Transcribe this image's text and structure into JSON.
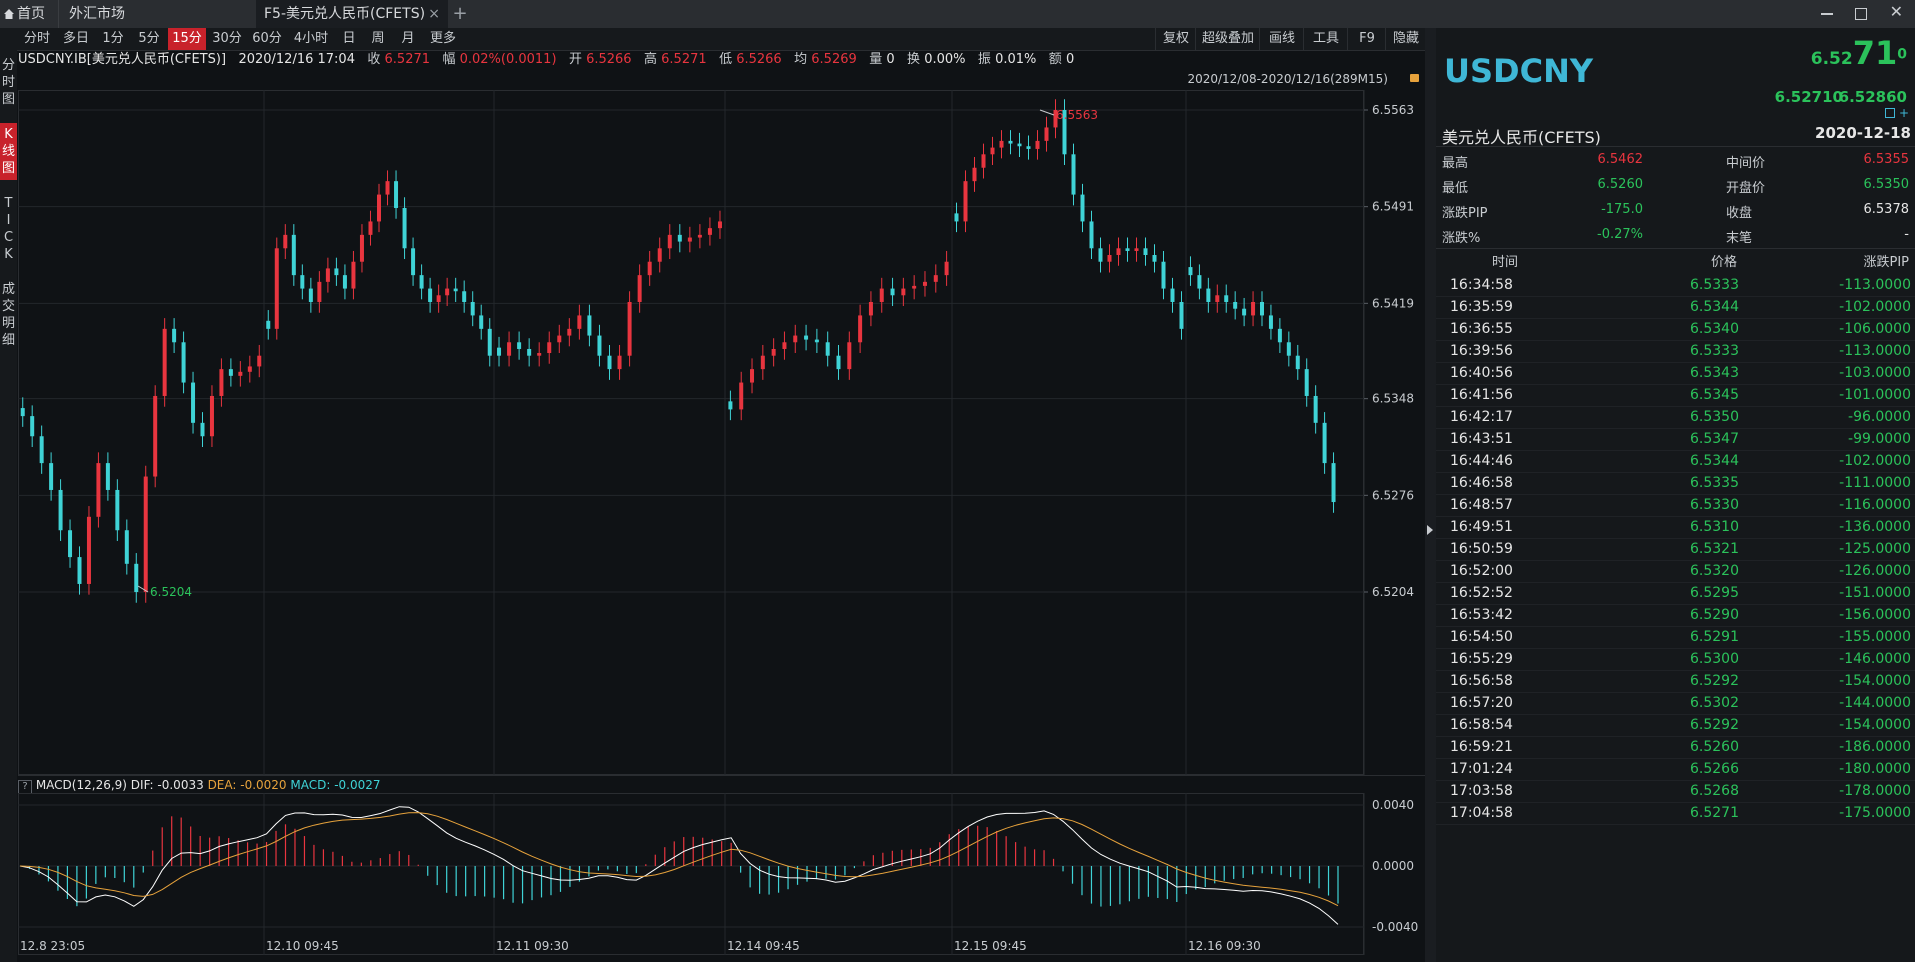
{
  "tabs": {
    "home": "首页",
    "fx_market": "外汇市场",
    "active_tab": "F5-美元兑人民币(CFETS)",
    "close_glyph": "×",
    "add_glyph": "+"
  },
  "toolbar": {
    "periods": [
      "分时",
      "多日",
      "1分",
      "5分",
      "15分",
      "30分",
      "60分",
      "4小时",
      "日",
      "周",
      "月",
      "更多"
    ],
    "active_period": "15分",
    "right_items": [
      "复权",
      "超级叠加",
      "画线",
      "工具",
      "F9",
      "隐藏"
    ]
  },
  "side_tabs": [
    {
      "label": "分时图",
      "active": false
    },
    {
      "label": "K线图",
      "active": true
    },
    {
      "label": "TICK",
      "active": false
    },
    {
      "label": "成交明细",
      "active": false
    }
  ],
  "info": {
    "symbol": "USDCNY.IB[美元兑人民币(CFETS)]",
    "datetime": "2020/12/16 17:04",
    "close_label": "收",
    "close": "6.5271",
    "amp_label": "幅",
    "amp": "0.02%(0.0011)",
    "open_label": "开",
    "open": "6.5266",
    "high_label": "高",
    "high": "6.5271",
    "low_label": "低",
    "low": "6.5266",
    "avg_label": "均",
    "avg": "6.5269",
    "vol_label": "量",
    "vol": "0",
    "turnover_label": "换",
    "turnover": "0.00%",
    "swing_label": "振",
    "swing": "0.01%",
    "amount_label": "额",
    "amount": "0",
    "range": "2020/12/08-2020/12/16(289M15)"
  },
  "macd": {
    "title": "MACD(12,26,9)",
    "dif_label": "DIF: -0.0033",
    "dea_label": "DEA: -0.0020",
    "macd_label": "MACD: -0.0027",
    "axis": [
      "0.0040",
      "0.0000",
      "-0.0040"
    ]
  },
  "chart_data": {
    "type": "candlestick",
    "y_ticks": [
      "6.5563",
      "6.5491",
      "6.5419",
      "6.5348",
      "6.5276",
      "6.5204"
    ],
    "ylim": [
      6.5204,
      6.5563
    ],
    "x_ticks": [
      "12.8 23:05",
      "12.10 09:45",
      "12.11 09:30",
      "12.14 09:45",
      "12.15 09:45",
      "12.16 09:30"
    ],
    "annotations": {
      "max": "6.5563",
      "min": "6.5204"
    },
    "colors": {
      "up": "#e8353f",
      "down": "#3fd3d6",
      "bg": "#0f1215",
      "dif": "#ffffff",
      "dea": "#e6a23c"
    },
    "segments": [
      {
        "label": "12.8 23:05",
        "points": [
          6.5335,
          6.532,
          6.53,
          6.528,
          6.525,
          6.523,
          6.521,
          6.526,
          6.53,
          6.528,
          6.525,
          6.5225,
          6.5204,
          6.529,
          6.535,
          6.54,
          6.539,
          6.536,
          6.533,
          6.532,
          6.535,
          6.537,
          6.5365,
          6.5368,
          6.5372,
          6.538
        ]
      },
      {
        "label": "12.10 09:45",
        "points": [
          6.54,
          6.546,
          6.547,
          6.544,
          6.543,
          6.542,
          6.5435,
          6.5445,
          6.544,
          6.543,
          6.545,
          6.547,
          6.548,
          6.55,
          6.551,
          6.549,
          6.546,
          6.544,
          6.543,
          6.542,
          6.5425,
          6.543,
          6.5428,
          6.542,
          6.541,
          6.54,
          6.538
        ]
      },
      {
        "label": "12.11 09:30",
        "points": [
          6.538,
          6.539,
          6.5385,
          6.538,
          6.5382,
          6.539,
          6.5395,
          6.54,
          6.541,
          6.5395,
          6.538,
          6.537,
          6.538,
          6.542,
          6.544,
          6.545,
          6.546,
          6.547,
          6.5465,
          6.5468,
          6.547,
          6.5475,
          6.548
        ]
      },
      {
        "label": "12.14 09:45",
        "points": [
          6.534,
          6.536,
          6.537,
          6.538,
          6.5385,
          6.539,
          6.5395,
          6.5392,
          6.539,
          6.538,
          6.537,
          6.539,
          6.541,
          6.542,
          6.543,
          6.5425,
          6.543,
          6.5432,
          6.5435,
          6.544,
          6.545
        ]
      },
      {
        "label": "12.15 09:45",
        "points": [
          6.548,
          6.551,
          6.552,
          6.553,
          6.5535,
          6.554,
          6.5538,
          6.5536,
          6.5534,
          6.554,
          6.555,
          6.5563,
          6.553,
          6.55,
          6.548,
          6.546,
          6.545,
          6.5455,
          6.546,
          6.5458,
          6.546,
          6.5455,
          6.545,
          6.543,
          6.542,
          6.54
        ]
      },
      {
        "label": "12.16 09:30",
        "points": [
          6.544,
          6.543,
          6.542,
          6.5425,
          6.542,
          6.5415,
          6.541,
          6.542,
          6.541,
          6.54,
          6.539,
          6.538,
          6.537,
          6.535,
          6.533,
          6.53,
          6.5271
        ]
      }
    ]
  },
  "quote": {
    "code": "USDCNY",
    "price_small": "6.52",
    "price_big": "71",
    "price_tail": "0",
    "bid": "6.52710",
    "ask": "6.52860",
    "name": "美元兑人民币(CFETS)",
    "help": "?",
    "date": "2020-12-18",
    "stats": [
      {
        "label": "最高",
        "value": "6.5462",
        "color": "red",
        "label2": "中间价",
        "value2": "6.5355",
        "color2": "red"
      },
      {
        "label": "最低",
        "value": "6.5260",
        "color": "green",
        "label2": "开盘价",
        "value2": "6.5350",
        "color2": "green"
      },
      {
        "label": "涨跌PIP",
        "value": "-175.0",
        "color": "green",
        "label2": "收盘",
        "value2": "6.5378",
        "color2": "white"
      },
      {
        "label": "涨跌%",
        "value": "-0.27%",
        "color": "green",
        "label2": "末笔",
        "value2": "-",
        "color2": "white"
      }
    ]
  },
  "ticks": {
    "headers": [
      "时间",
      "价格",
      "涨跌PIP"
    ],
    "rows": [
      [
        "16:34:58",
        "6.5333",
        "-113.0000"
      ],
      [
        "16:35:59",
        "6.5344",
        "-102.0000"
      ],
      [
        "16:36:55",
        "6.5340",
        "-106.0000"
      ],
      [
        "16:39:56",
        "6.5333",
        "-113.0000"
      ],
      [
        "16:40:56",
        "6.5343",
        "-103.0000"
      ],
      [
        "16:41:56",
        "6.5345",
        "-101.0000"
      ],
      [
        "16:42:17",
        "6.5350",
        "-96.0000"
      ],
      [
        "16:43:51",
        "6.5347",
        "-99.0000"
      ],
      [
        "16:44:46",
        "6.5344",
        "-102.0000"
      ],
      [
        "16:46:58",
        "6.5335",
        "-111.0000"
      ],
      [
        "16:48:57",
        "6.5330",
        "-116.0000"
      ],
      [
        "16:49:51",
        "6.5310",
        "-136.0000"
      ],
      [
        "16:50:59",
        "6.5321",
        "-125.0000"
      ],
      [
        "16:52:00",
        "6.5320",
        "-126.0000"
      ],
      [
        "16:52:52",
        "6.5295",
        "-151.0000"
      ],
      [
        "16:53:42",
        "6.5290",
        "-156.0000"
      ],
      [
        "16:54:50",
        "6.5291",
        "-155.0000"
      ],
      [
        "16:55:29",
        "6.5300",
        "-146.0000"
      ],
      [
        "16:56:58",
        "6.5292",
        "-154.0000"
      ],
      [
        "16:57:20",
        "6.5302",
        "-144.0000"
      ],
      [
        "16:58:54",
        "6.5292",
        "-154.0000"
      ],
      [
        "16:59:21",
        "6.5260",
        "-186.0000"
      ],
      [
        "17:01:24",
        "6.5266",
        "-180.0000"
      ],
      [
        "17:03:58",
        "6.5268",
        "-178.0000"
      ],
      [
        "17:04:58",
        "6.5271",
        "-175.0000"
      ]
    ]
  }
}
